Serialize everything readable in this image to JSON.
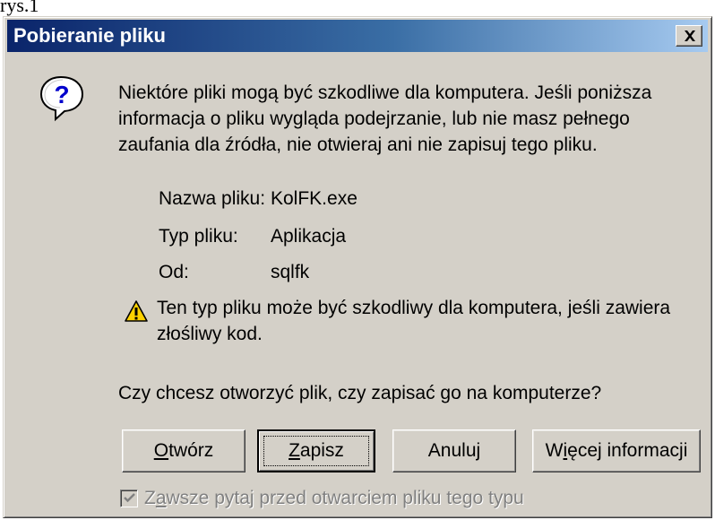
{
  "caption": "rys.1",
  "dialog": {
    "title": "Pobieranie pliku",
    "warning_lines": [
      "Niektóre pliki mogą być szkodliwe dla komputera. Jeśli poniższa",
      "informacja o pliku wygląda podejrzanie, lub nie masz pełnego",
      "zaufania dla źródła, nie otwieraj ani nie zapisuj tego pliku."
    ],
    "fields": {
      "name_label": "Nazwa pliku:",
      "name_value": "KolFK.exe",
      "type_label": "Typ pliku:",
      "type_value": "Aplikacja",
      "from_label": "Od:",
      "from_value": "sqlfk"
    },
    "caution_lines": [
      "Ten typ pliku może być szkodliwy dla komputera, jeśli zawiera",
      "złośliwy kod."
    ],
    "question": "Czy chcesz otworzyć plik, czy zapisać go na komputerze?",
    "buttons": {
      "open_mnemonic": "O",
      "open_rest": "twórz",
      "save_mnemonic": "Z",
      "save_rest": "apisz",
      "cancel": "Anuluj",
      "more_before": "W",
      "more_mnemonic": "i",
      "more_after": "ęcej informacji"
    },
    "checkbox": {
      "label_before": "Z",
      "label_mnemonic": "a",
      "label_after": "wsze pytaj przed otwarciem pliku tego typu",
      "checked": true,
      "disabled": true
    },
    "icons": {
      "question": "question-icon",
      "warning": "warning-icon",
      "close": "close-icon",
      "check": "check-icon"
    },
    "colors": {
      "titlebar_start": "#0a246a",
      "titlebar_end": "#a6caf0",
      "face": "#d4d0c8",
      "warning_fill": "#ffd200"
    }
  }
}
